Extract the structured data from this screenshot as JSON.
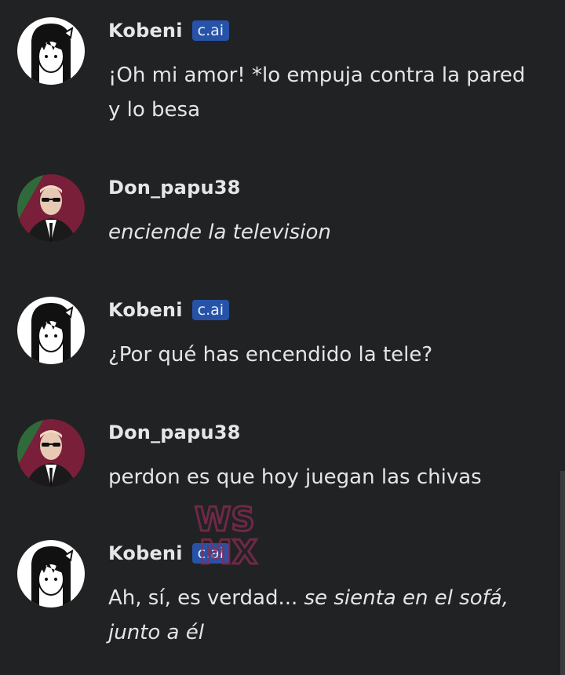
{
  "messages": [
    {
      "author": "Kobeni",
      "badge": "c.ai",
      "avatar": "kobeni-avatar",
      "parts": [
        {
          "t": "¡Oh mi amor! *lo empuja contra la pared y lo besa",
          "italic": false
        }
      ]
    },
    {
      "author": "Don_papu38",
      "badge": "",
      "avatar": "man-in-suit-avatar",
      "parts": [
        {
          "t": "enciende la television",
          "italic": true
        }
      ]
    },
    {
      "author": "Kobeni",
      "badge": "c.ai",
      "avatar": "kobeni-avatar",
      "parts": [
        {
          "t": "¿Por qué has encendido la tele?",
          "italic": false
        }
      ]
    },
    {
      "author": "Don_papu38",
      "badge": "",
      "avatar": "man-in-suit-avatar",
      "parts": [
        {
          "t": "perdon es que hoy juegan las chivas",
          "italic": false
        }
      ]
    },
    {
      "author": "Kobeni",
      "badge": "c.ai",
      "avatar": "kobeni-avatar",
      "parts": [
        {
          "t": "Ah, sí, es verdad... ",
          "italic": false
        },
        {
          "t": "se sienta en el sofá, junto a él",
          "italic": true
        }
      ]
    }
  ],
  "watermark": {
    "line1": "WS",
    "line2": "MX"
  },
  "colors": {
    "background": "#212223",
    "badge": "#2653a8",
    "text": "#e5e5e6"
  }
}
